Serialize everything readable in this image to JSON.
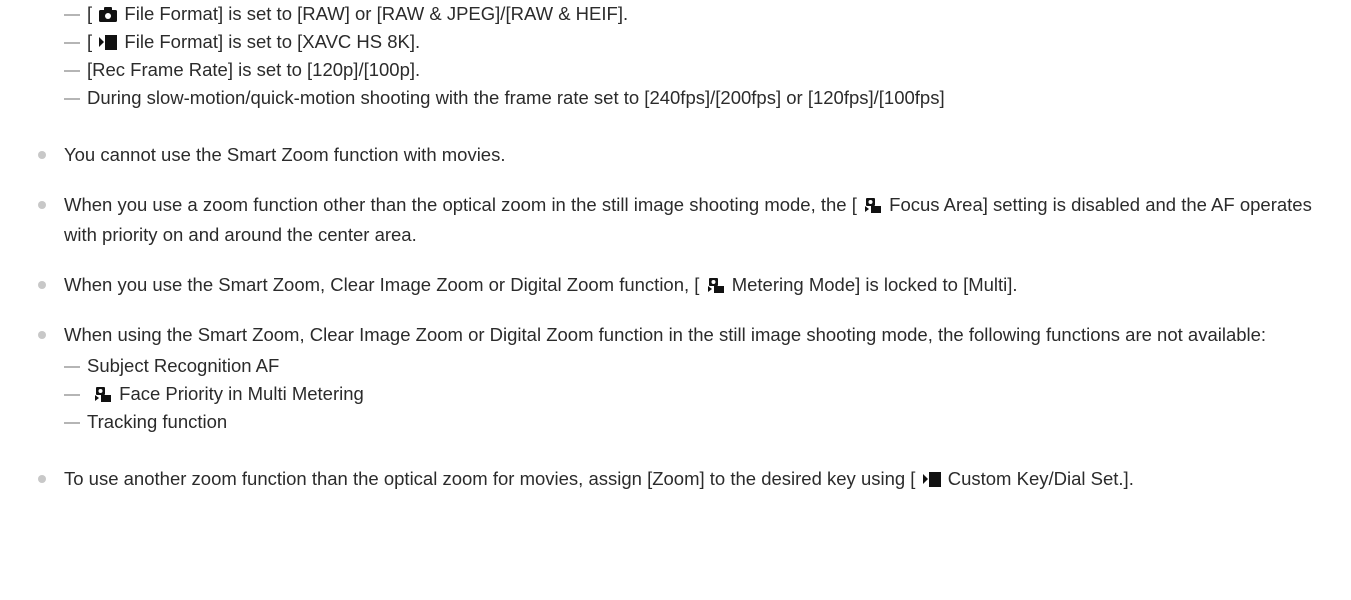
{
  "sub_items_top": [
    {
      "pre": "[",
      "icon": "camera-icon",
      "post": "File Format] is set to [RAW] or [RAW & JPEG]/[RAW & HEIF]."
    },
    {
      "pre": "[",
      "icon": "movie-icon",
      "post": "File Format] is set to [XAVC HS 8K]."
    },
    {
      "pre": "",
      "icon": "",
      "post": "[Rec Frame Rate] is set to [120p]/[100p]."
    },
    {
      "pre": "",
      "icon": "",
      "post": "During slow-motion/quick-motion shooting with the frame rate set to [240fps]/[200fps] or [120fps]/[100fps]"
    }
  ],
  "bullets": {
    "b1": "You cannot use the Smart Zoom function with movies.",
    "b2_pre": "When you use a zoom function other than the optical zoom in the still image shooting mode, the [",
    "b2_icon": "still-movie-icon",
    "b2_post": "Focus Area] setting is disabled and the AF operates with priority on and around the center area.",
    "b3_pre": "When you use the Smart Zoom, Clear Image Zoom or Digital Zoom function, [",
    "b3_icon": "still-movie-icon",
    "b3_post": "Metering Mode] is locked to [Multi].",
    "b4": "When using the Smart Zoom, Clear Image Zoom or Digital Zoom function in the still image shooting mode, the following functions are not available:",
    "b4_items": [
      {
        "icon": "",
        "text": "Subject Recognition AF"
      },
      {
        "icon": "still-movie-icon",
        "text": "Face Priority in Multi Metering"
      },
      {
        "icon": "",
        "text": "Tracking function"
      }
    ],
    "b5_pre": "To use another zoom function than the optical zoom for movies, assign [Zoom] to the desired key using [",
    "b5_icon": "movie-icon",
    "b5_post": "Custom Key/Dial Set.]."
  }
}
